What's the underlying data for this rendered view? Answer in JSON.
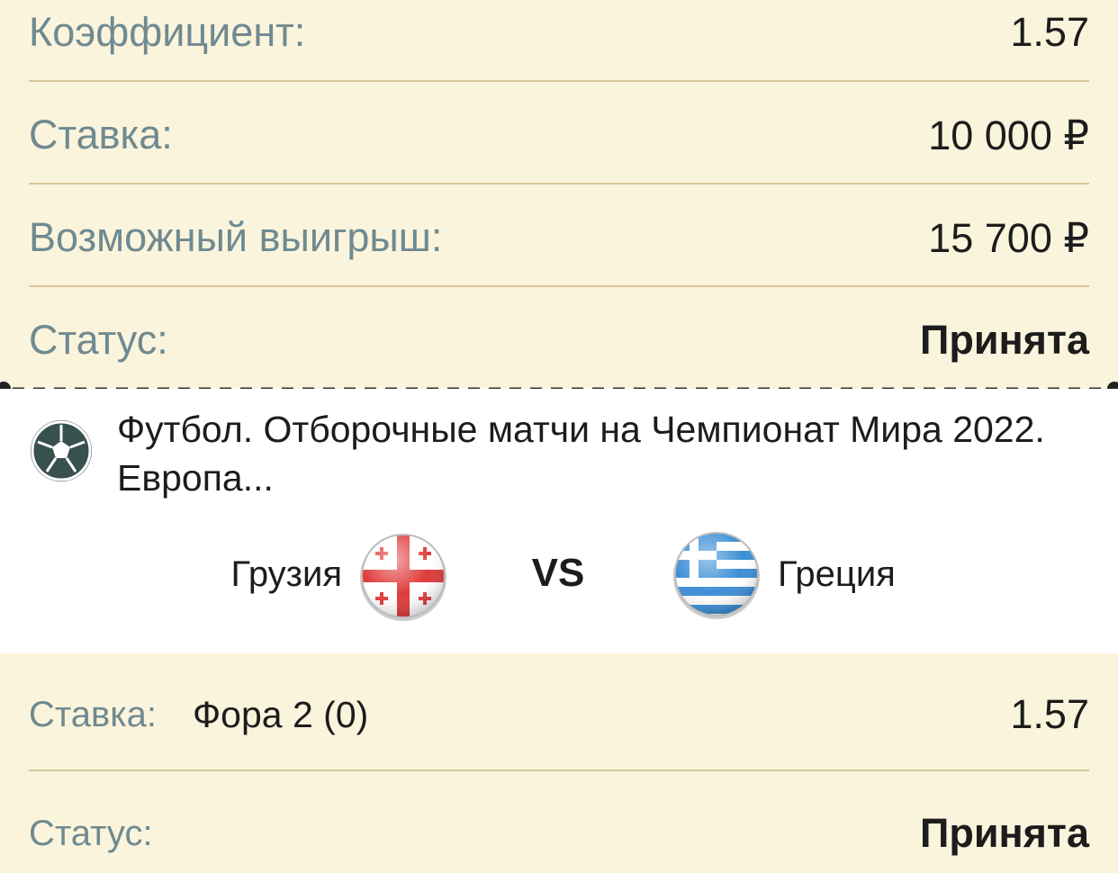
{
  "summary": {
    "rows": [
      {
        "label": "Коэффициент:",
        "value": "1.57"
      },
      {
        "label": "Ставка:",
        "value": "10 000 ₽"
      },
      {
        "label": "Возможный выигрыш:",
        "value": "15 700 ₽"
      },
      {
        "label": "Статус:",
        "value": "Принята"
      }
    ]
  },
  "event": {
    "sport_icon": "soccer-ball-icon",
    "league": "Футбол. Отборочные матчи на Чемпионат Мира 2022. Европа...",
    "home_team": "Грузия",
    "home_flag": "georgia-flag-icon",
    "vs": "VS",
    "away_team": "Греция",
    "away_flag": "greece-flag-icon"
  },
  "bet": {
    "label": "Ставка:",
    "description": "Фора 2 (0)",
    "odds": "1.57",
    "status_label": "Статус:",
    "status_value": "Принята"
  },
  "colors": {
    "background": "#fbf4dc",
    "label": "#6f8a90",
    "divider": "#d6c79b",
    "text": "#1c1c1c"
  }
}
